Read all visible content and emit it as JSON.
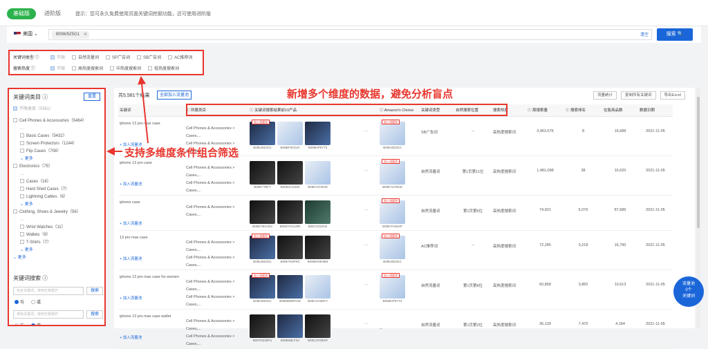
{
  "tabs": [
    "基础版",
    "进阶版"
  ],
  "hint": "提示：您可永久免费使用页面关键词挖掘功能，还可使用进阶版",
  "search": {
    "country": "美国",
    "chip": "B096/9Z5G1",
    "clear": "清空",
    "button": "搜索 🔍"
  },
  "filters": {
    "type_label": "关键词类型 ⓘ",
    "type_options": [
      "不限",
      "自然流量词",
      "SP广告词",
      "SB广告词",
      "AC推荐词"
    ],
    "heat_label": "搜索热度 ⓘ",
    "heat_options": [
      "不限",
      "高热度搜索词",
      "中热度搜索词",
      "低热度搜索词"
    ]
  },
  "left": {
    "title": "关键词类目 ⓘ",
    "btn": "重置",
    "items": [
      "不限类目（5581）",
      "Cell Phones & Accessories（5464）",
      "...",
      "Basic Cases（5432）",
      "Screen Protectors（1244）",
      "Flip Cases（708）",
      "更多",
      "Electronics（75）",
      "...",
      "Cases（16）",
      "Hard Shell Cases（7）",
      "Lightning Cables（6）",
      "更多",
      "Clothing, Shoes & Jewelry（56）",
      "...",
      "Wrist Watches（11）",
      "Wallets（9）",
      "T-Shirts（7）",
      "更多",
      "更多"
    ],
    "kw_title": "关键词搜索 ⓘ",
    "kw_placeholder1": "包含关键词，使用空格隔开",
    "kw_placeholder2": "排除关键词，使用空格隔开",
    "kw_btn": "搜索",
    "and": "与",
    "or": "或"
  },
  "result": {
    "count": "共5,581个结果",
    "addall": "全部加入流量池"
  },
  "tools": [
    "流量统计",
    "复制所有关键词",
    "导出Excel"
  ],
  "annot1": "新增多个维度的数据，避免分析盲点",
  "annot2": "支持多维度条件组合筛选",
  "headers": [
    "关键词",
    "所属类目",
    "关键词搜索结果前10产品",
    "",
    "Amazon's Choice",
    "关键词类型",
    "自然搜索位置",
    "搜索热度",
    "周搜索量",
    "搜索排名",
    "在售商品数",
    "数据日期"
  ],
  "rows": [
    {
      "kw": "iphone 13 pro max case",
      "cat1": "Cell Phones & Accessories > Cases,...",
      "cat2": "Cell Phones & Accessories > Access...",
      "asins": [
        "B096J9Z3G1",
        "B09BP2KZLR",
        "B098HP9YT3"
      ],
      "ac": "B096J9Z3G1",
      "type": "SB广告词",
      "pos": "--",
      "heat": "高热度搜索词",
      "vol": "3,463,676",
      "rank": "8",
      "goods": "16,688",
      "date": "2021-11-05"
    },
    {
      "kw": "iphone 13 pro case",
      "cat1": "Cell Phones & Accessories > Cases,...",
      "cat2": "Cell Phones & Accessories > Cases,...",
      "asins": [
        "B09E7T9FT",
        "B096GCZ3Z9",
        "B09E7LF6KW"
      ],
      "ac": "B09E7LF6KW",
      "type": "自然流量词",
      "pos": "第1页第11位",
      "heat": "高热度搜索词",
      "vol": "1,481,098",
      "rank": "38",
      "goods": "15,620",
      "date": "2021-11-05"
    },
    {
      "kw": "iphone case",
      "cat1": "Cell Phones & Accessories > Cases,...",
      "cat2": "",
      "asins": [
        "B08DYBGJN4",
        "B08DYS1LWR",
        "B08CXZ33H2"
      ],
      "ac": "B08DYNJN4P",
      "type": "自然流量词",
      "pos": "第1页第6位",
      "heat": "高热度搜索词",
      "vol": "74,921",
      "rank": "5,076",
      "goods": "87,686",
      "date": "2021-11-05"
    },
    {
      "kw": "13 pro max case",
      "cat1": "Cell Phones & Accessories > Cases,...",
      "cat2": "Cell Phones & Accessories > Cases,...",
      "asins": [
        "B096J9Z3G1",
        "B09E7K9PRZ",
        "B098DN3HBM"
      ],
      "ac": "B096J9Z3G1",
      "type": "AC推荐词",
      "pos": "--",
      "heat": "高热度搜索词",
      "vol": "72,285",
      "rank": "3,218",
      "goods": "16,790",
      "date": "2021-11-05"
    },
    {
      "kw": "iphone 13 pro max case for women",
      "cat1": "Cell Phones & Accessories > Cases,...",
      "cat2": "Cell Phones & Accessories > Cases,...",
      "asins": [
        "B096J9Z3G1",
        "B098M5RRVW",
        "B08CSV5DFV"
      ],
      "ac": "B098HP9YT3",
      "type": "自然流量词",
      "pos": "第1页第8位",
      "heat": "高热度搜索词",
      "vol": "60,858",
      "rank": "3,882",
      "goods": "10,613",
      "date": "2021-11-05"
    },
    {
      "kw": "iphone 13 pro max case wallet",
      "cat1": "Cell Phones & Accessories > Cases,...",
      "cat2": "Cell Phones & Accessories > Cases,...",
      "asins": [
        "B09TDZ2kPU",
        "B09B2BLF3X",
        "B09C1PZBKR"
      ],
      "ac": "--",
      "type": "自然流量词",
      "pos": "第1页第2位",
      "heat": "高热度搜索词",
      "vol": "36,139",
      "rank": "7,470",
      "goods": "4,184",
      "date": "2021-11-05"
    }
  ],
  "addpool": "+ 加入流量池",
  "tag": "加入流量池",
  "float": {
    "l1": "流量池",
    "l2": "0个",
    "l3": "关键词"
  }
}
